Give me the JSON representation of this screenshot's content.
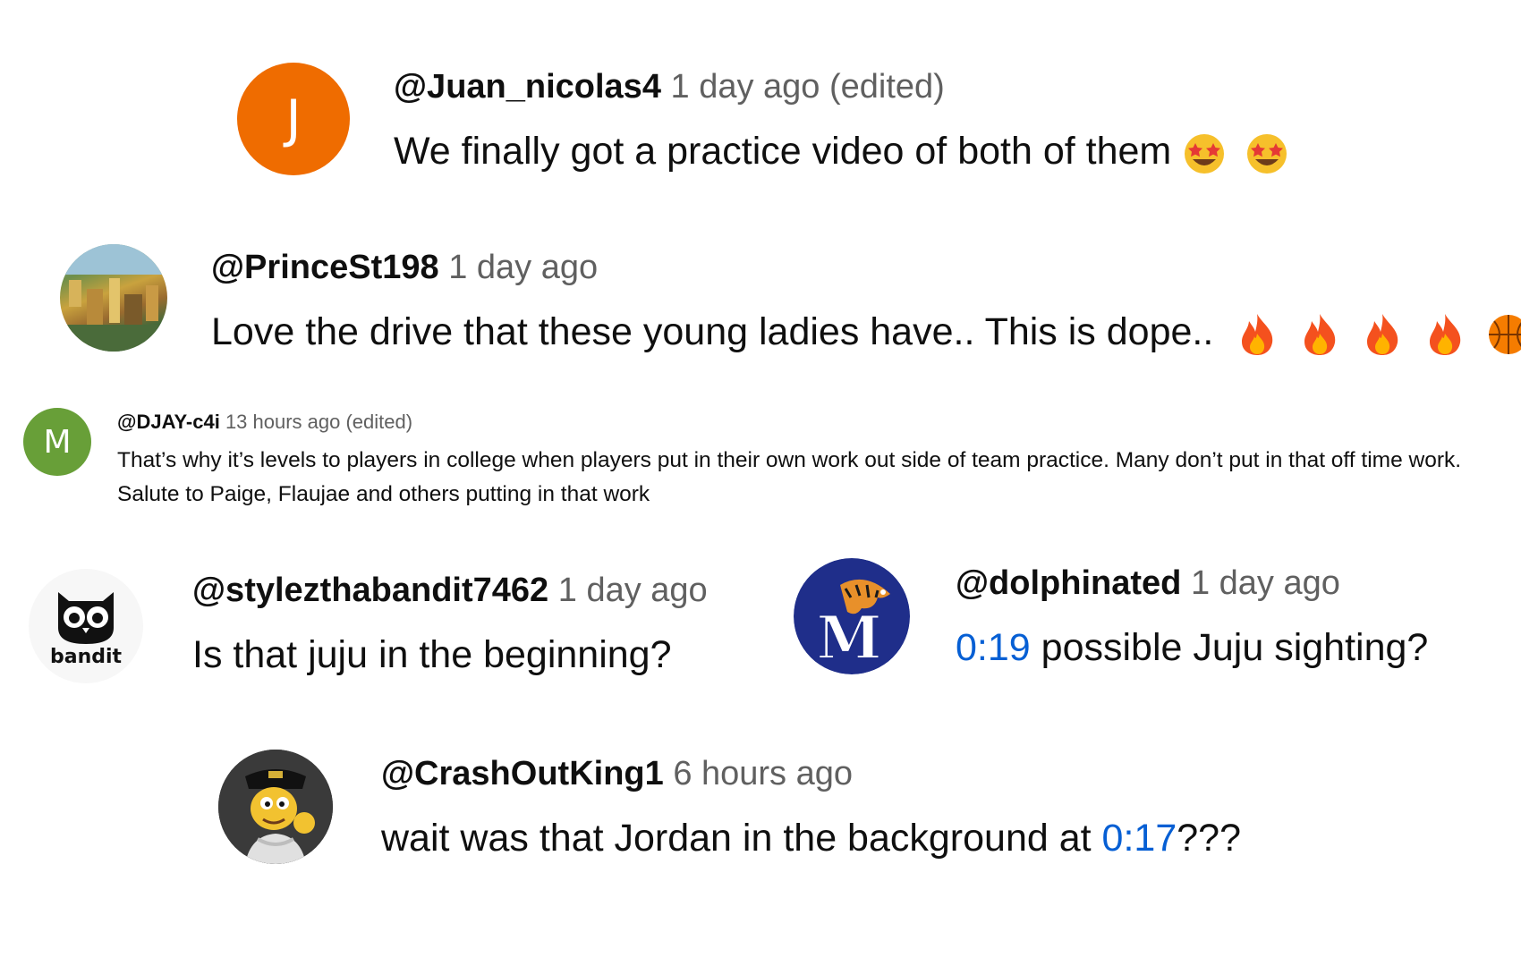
{
  "comments": [
    {
      "handle": "@Juan_nicolas4",
      "time": "1 day ago (edited)",
      "avatar_letter": "J",
      "avatar_color": "#ef6c00",
      "text": "We finally got a practice video of both of them",
      "emojis": [
        "star-struck",
        "star-struck"
      ]
    },
    {
      "handle": "@PrinceSt198",
      "time": "1 day ago",
      "avatar": "city-photo",
      "text": "Love the drive that these young ladies have.. This is dope..",
      "emojis": [
        "fire",
        "fire",
        "fire",
        "fire",
        "basketball"
      ]
    },
    {
      "handle": "@DJAY-c4i",
      "time": "13 hours ago (edited)",
      "avatar_letter": "M",
      "avatar_color": "#689f38",
      "text": "That’s why it’s levels to players in college when players put in their own work out side of team practice. Many don’t put in that off time work. Salute to Paige,  Flaujae and others putting in that work"
    },
    {
      "handle": "@stylezthabandit7462",
      "time": "1 day ago",
      "avatar": "bandit-owl-logo",
      "avatar_text": "bandit",
      "text": "Is that juju in the beginning?"
    },
    {
      "handle": "@dolphinated",
      "time": "1 day ago",
      "avatar": "memphis-tiger-logo",
      "avatar_text": "M",
      "timestamp": "0:19",
      "text": " possible Juju sighting?"
    },
    {
      "handle": "@CrashOutKing1",
      "time": "6 hours ago",
      "avatar": "cartoon-character",
      "text_before": "wait was that Jordan in the background at ",
      "timestamp": "0:17",
      "text_after": "???"
    }
  ],
  "colors": {
    "timestamp_link": "#065fd4",
    "meta_gray": "#606060"
  }
}
